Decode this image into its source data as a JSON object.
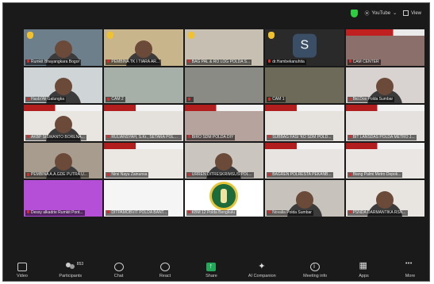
{
  "topbar": {
    "stream_label": "YouTube",
    "view_label": "View"
  },
  "tiles": [
    {
      "name": "Rumkit Bhayangkara Bogor",
      "hand": true,
      "bg": "#6d7f8a",
      "person": true
    },
    {
      "name": "PEMBINA TK I TIARA AR...",
      "hand": true,
      "bg": "#c9b58b",
      "person": true
    },
    {
      "name": "BAG PAL & RO LOG POLDA S...",
      "hand": true,
      "bg": "#c7c0b2",
      "person": false
    },
    {
      "name": "dr.Hambekanuhita",
      "hand": true,
      "bg": "#2a2a2a",
      "avatar": "S"
    },
    {
      "name": "CAM CENTER",
      "hand": false,
      "bg": "#8a6f6a",
      "banner": "red"
    },
    {
      "name": "Hasbi'Ali Galungka",
      "hand": false,
      "bg": "#cfd4d6",
      "person": true
    },
    {
      "name": "CAM 2",
      "hand": false,
      "bg": "#a7b0a8"
    },
    {
      "name": "",
      "hand": false,
      "bg": "#8b8b86"
    },
    {
      "name": "CAM 1",
      "hand": false,
      "bg": "#6e6a5a"
    },
    {
      "name": "Bid.Dos Polda Sumbar",
      "hand": false,
      "bg": "#d8d3d0",
      "person": true
    },
    {
      "name": "AKBP SISWANTO BORENA...",
      "hand": false,
      "bg": "#e9e6e2",
      "banner": "normal",
      "person": true
    },
    {
      "name": "RULIANSYAH, S.Kr., SETARA POLD...",
      "hand": false,
      "bg": "#e4e0dc",
      "banner": "normal"
    },
    {
      "name": "BIRO SDM POLDA DIY",
      "hand": false,
      "bg": "#b7a39d",
      "banner": "normal"
    },
    {
      "name": "SUBBAG FASI 'KO SDM POLD...",
      "hand": false,
      "bg": "#e6e2de",
      "banner": "normal"
    },
    {
      "name": "BIT LANSDAS POLDA METRO J...",
      "hand": false,
      "bg": "#e4e1de",
      "banner": "normal"
    },
    {
      "name": "PEMBINA A.A.GDE PUTRA U...",
      "hand": false,
      "bg": "#a89c8f",
      "person": true
    },
    {
      "name": "Nirsi Nayu Zainunsa",
      "hand": false,
      "bg": "#ebe7e3",
      "banner": "normal"
    },
    {
      "name": "URREN DITRESKRIMSUS POL...",
      "hand": false,
      "bg": "#cbc5c0",
      "person": true
    },
    {
      "name": "BAGREN POLRESTA PEKANB...",
      "hand": false,
      "bg": "#e7e4e1",
      "banner": "normal"
    },
    {
      "name": "Biang Palmi Metro Depok...",
      "hand": false,
      "bg": "#e9e6e3",
      "banner": "normal"
    },
    {
      "name": "Dessy alkadrie Rumkit Pont...",
      "hand": false,
      "bg": "#b64fd8"
    },
    {
      "name": "DITPAMOBVIT POLDA BANT...",
      "hand": false,
      "bg": "#f5f5f5"
    },
    {
      "name": "KBM 12 Polda Bengkulu",
      "hand": false,
      "bg": "#ffffff",
      "logo": true
    },
    {
      "name": "Novalia Polda Sumbar",
      "hand": false,
      "bg": "#c8c2bd",
      "person": true
    },
    {
      "name": "PSNDA DARMANTIKA RSN...",
      "hand": false,
      "bg": "#e8e5e1",
      "person": true
    }
  ],
  "toolbar": [
    {
      "id": "video",
      "label": "Video",
      "icon": "video-icon"
    },
    {
      "id": "participants",
      "label": "Participants",
      "icon": "participants-icon",
      "count": "853"
    },
    {
      "id": "chat",
      "label": "Chat",
      "icon": "chat-icon"
    },
    {
      "id": "react",
      "label": "React",
      "icon": "react-icon"
    },
    {
      "id": "share",
      "label": "Share",
      "icon": "share-icon"
    },
    {
      "id": "ai",
      "label": "AI Companion",
      "icon": "ai-companion-icon"
    },
    {
      "id": "info",
      "label": "Meeting info",
      "icon": "info-icon"
    },
    {
      "id": "apps",
      "label": "Apps",
      "icon": "apps-icon"
    },
    {
      "id": "more",
      "label": "More",
      "icon": "more-icon"
    }
  ],
  "colors": {
    "window_bg": "#1a1a1a",
    "share_green": "#23a85a",
    "secure_green": "#2ecc40",
    "raise_hand": "#f2c12e",
    "muted_red": "#e02828"
  }
}
